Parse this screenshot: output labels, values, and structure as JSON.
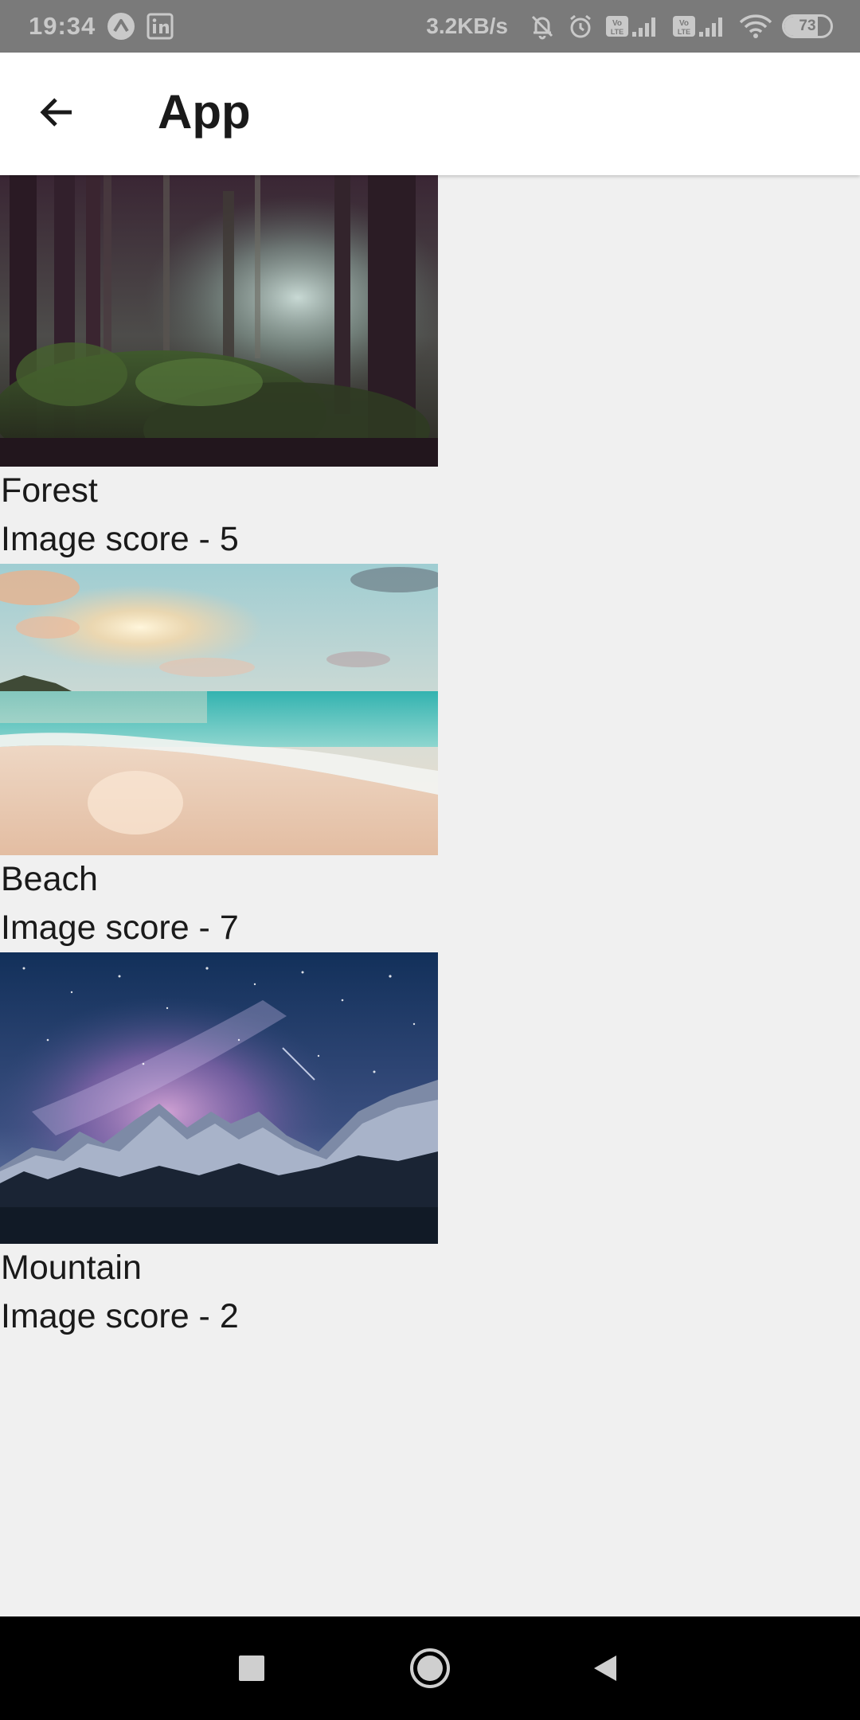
{
  "status_bar": {
    "time": "19:34",
    "network_speed": "3.2KB/s",
    "battery_level": "73",
    "battery_fraction": 0.73
  },
  "app_bar": {
    "title": "App",
    "back_icon": "arrow-left-icon"
  },
  "items": [
    {
      "title": "Forest",
      "score_text": "Image score - 5",
      "image": "forest-photo"
    },
    {
      "title": "Beach",
      "score_text": "Image score - 7",
      "image": "beach-photo"
    },
    {
      "title": "Mountain",
      "score_text": "Image score - 2",
      "image": "mountain-photo"
    }
  ],
  "nav_bar": {
    "recents_icon": "square-icon",
    "home_icon": "circle-icon",
    "back_icon": "triangle-back-icon"
  },
  "colors": {
    "background": "#f0f0f0",
    "app_bar": "#ffffff",
    "status_bar": "#7a7a7a",
    "nav_bar": "#000000"
  }
}
